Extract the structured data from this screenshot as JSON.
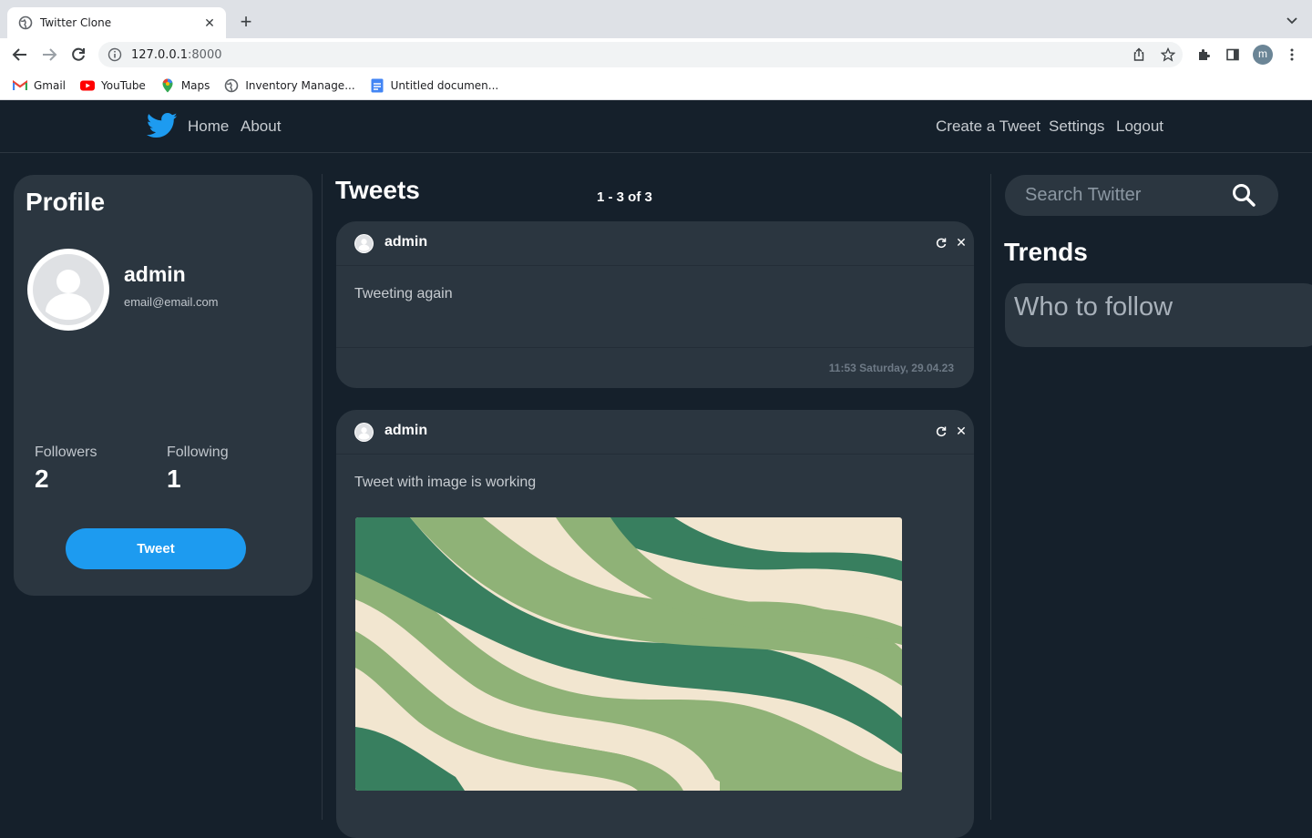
{
  "browser": {
    "tab_title": "Twitter Clone",
    "new_tab": "+",
    "url_host": "127.0.0.1",
    "url_port": ":8000",
    "profile_initial": "m",
    "bookmarks": [
      {
        "label": "Gmail",
        "icon": "gmail-icon"
      },
      {
        "label": "YouTube",
        "icon": "youtube-icon"
      },
      {
        "label": "Maps",
        "icon": "maps-icon"
      },
      {
        "label": "Inventory Manage...",
        "icon": "globe-icon"
      },
      {
        "label": "Untitled documen...",
        "icon": "docs-icon"
      }
    ]
  },
  "nav": {
    "home": "Home",
    "about": "About",
    "create": "Create a Tweet",
    "settings": "Settings",
    "logout": "Logout"
  },
  "profile": {
    "heading": "Profile",
    "name": "admin",
    "email": "email@email.com",
    "followers_label": "Followers",
    "followers_count": "2",
    "following_label": "Following",
    "following_count": "1",
    "tweet_button": "Tweet"
  },
  "feed": {
    "heading": "Tweets",
    "pagination": "1 - 3 of 3",
    "tweets": [
      {
        "user": "admin",
        "text": "Tweeting again",
        "time": "11:53 Saturday, 29.04.23"
      },
      {
        "user": "admin",
        "text": "Tweet with image is working",
        "time": ""
      }
    ]
  },
  "sidebar": {
    "search_placeholder": "Search Twitter",
    "trends_heading": "Trends",
    "who_to_follow": "Who to follow"
  },
  "colors": {
    "background": "#15202b",
    "card": "#2b3640",
    "accent": "#1d9bf0"
  }
}
